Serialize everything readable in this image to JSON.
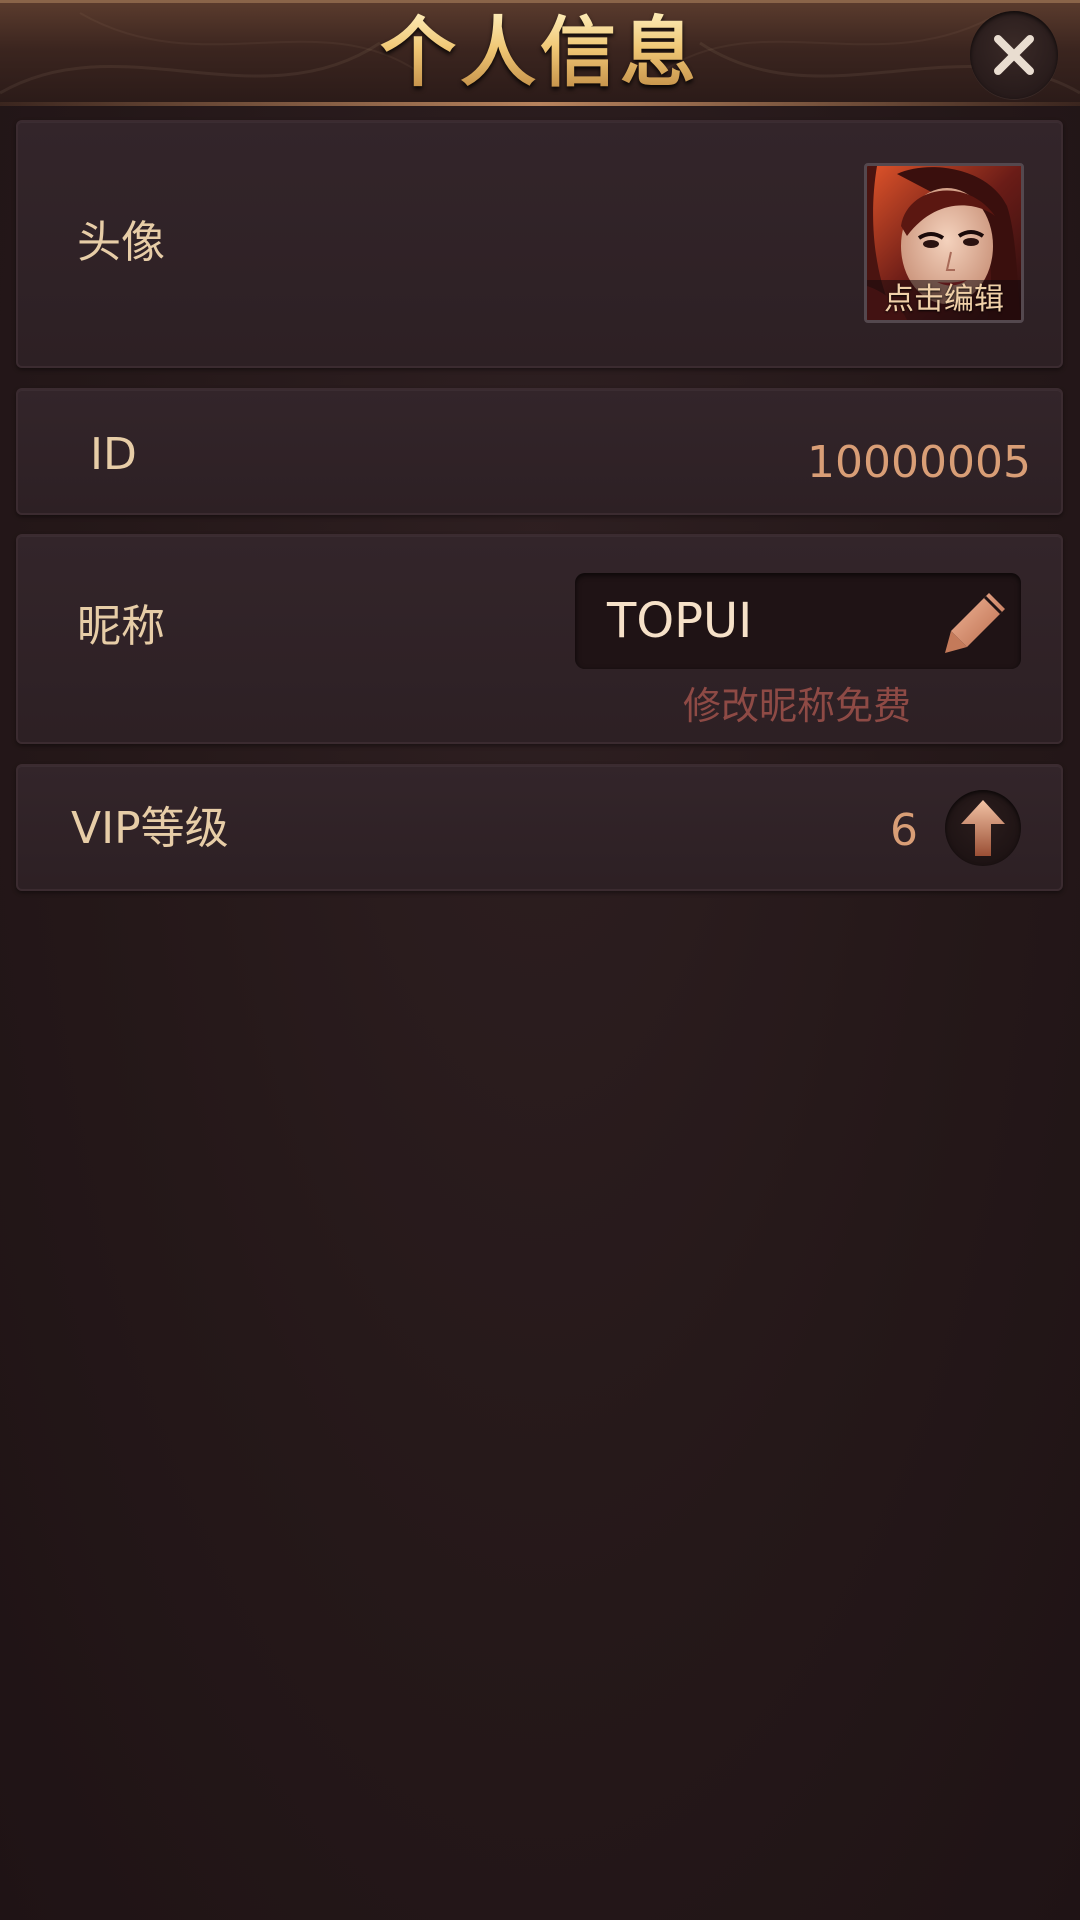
{
  "header": {
    "title": "个人信息",
    "close_icon": "close-icon"
  },
  "avatar_row": {
    "label": "头像",
    "caption": "点击编辑",
    "image": "portrait of a woman with red hair"
  },
  "id_row": {
    "label": "ID",
    "value": "10000005"
  },
  "nickname_row": {
    "label": "昵称",
    "value": "TOPUI",
    "edit_icon": "pencil-icon",
    "hint": "修改昵称免费"
  },
  "vip_row": {
    "label": "VIP等级",
    "value": "6",
    "upgrade_icon": "arrow-up-icon"
  },
  "colors": {
    "background": "#241719",
    "label": "#e7cda7",
    "value": "#d99e76",
    "hint": "#8e4a45",
    "title_gold": "#f0c775"
  }
}
